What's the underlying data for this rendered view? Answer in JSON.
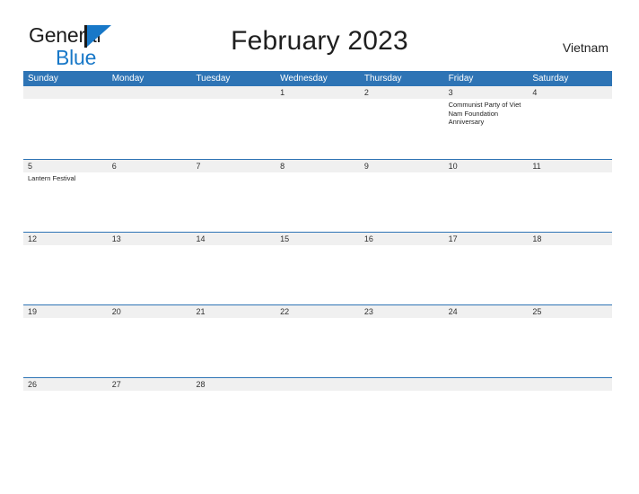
{
  "brand": {
    "line1": "General",
    "line2": "Blue",
    "flag_icon": "flag-triangle-icon",
    "colors": {
      "text": "#1c1c1c",
      "accent": "#1878c8"
    }
  },
  "header": {
    "title": "February 2023",
    "country": "Vietnam"
  },
  "theme": {
    "header_blue": "#2e74b5",
    "row_band": "#f0f0f0",
    "text": "#1f1f1f"
  },
  "calendar": {
    "weekdays": [
      "Sunday",
      "Monday",
      "Tuesday",
      "Wednesday",
      "Thursday",
      "Friday",
      "Saturday"
    ],
    "weeks": [
      [
        {
          "num": "",
          "events": []
        },
        {
          "num": "",
          "events": []
        },
        {
          "num": "",
          "events": []
        },
        {
          "num": "1",
          "events": []
        },
        {
          "num": "2",
          "events": []
        },
        {
          "num": "3",
          "events": [
            "Communist Party of Viet Nam Foundation Anniversary"
          ]
        },
        {
          "num": "4",
          "events": []
        }
      ],
      [
        {
          "num": "5",
          "events": [
            "Lantern Festival"
          ]
        },
        {
          "num": "6",
          "events": []
        },
        {
          "num": "7",
          "events": []
        },
        {
          "num": "8",
          "events": []
        },
        {
          "num": "9",
          "events": []
        },
        {
          "num": "10",
          "events": []
        },
        {
          "num": "11",
          "events": []
        }
      ],
      [
        {
          "num": "12",
          "events": []
        },
        {
          "num": "13",
          "events": []
        },
        {
          "num": "14",
          "events": []
        },
        {
          "num": "15",
          "events": []
        },
        {
          "num": "16",
          "events": []
        },
        {
          "num": "17",
          "events": []
        },
        {
          "num": "18",
          "events": []
        }
      ],
      [
        {
          "num": "19",
          "events": []
        },
        {
          "num": "20",
          "events": []
        },
        {
          "num": "21",
          "events": []
        },
        {
          "num": "22",
          "events": []
        },
        {
          "num": "23",
          "events": []
        },
        {
          "num": "24",
          "events": []
        },
        {
          "num": "25",
          "events": []
        }
      ],
      [
        {
          "num": "26",
          "events": []
        },
        {
          "num": "27",
          "events": []
        },
        {
          "num": "28",
          "events": []
        },
        {
          "num": "",
          "events": []
        },
        {
          "num": "",
          "events": []
        },
        {
          "num": "",
          "events": []
        },
        {
          "num": "",
          "events": []
        }
      ]
    ]
  }
}
